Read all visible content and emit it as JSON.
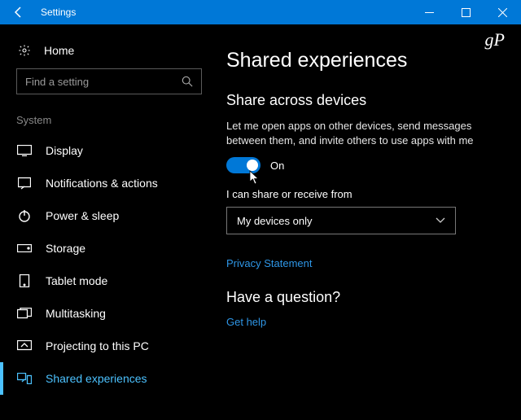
{
  "titlebar": {
    "title": "Settings"
  },
  "watermark": "gP",
  "sidebar": {
    "home": "Home",
    "search_placeholder": "Find a setting",
    "group": "System",
    "items": [
      {
        "label": "Display"
      },
      {
        "label": "Notifications & actions"
      },
      {
        "label": "Power & sleep"
      },
      {
        "label": "Storage"
      },
      {
        "label": "Tablet mode"
      },
      {
        "label": "Multitasking"
      },
      {
        "label": "Projecting to this PC"
      },
      {
        "label": "Shared experiences"
      }
    ]
  },
  "main": {
    "heading": "Shared experiences",
    "section1_title": "Share across devices",
    "section1_desc": "Let me open apps on other devices, send messages between them, and invite others to use apps with me",
    "toggle_state": "On",
    "share_from_label": "I can share or receive from",
    "share_from_value": "My devices only",
    "privacy_link": "Privacy Statement",
    "question_heading": "Have a question?",
    "help_link": "Get help"
  }
}
